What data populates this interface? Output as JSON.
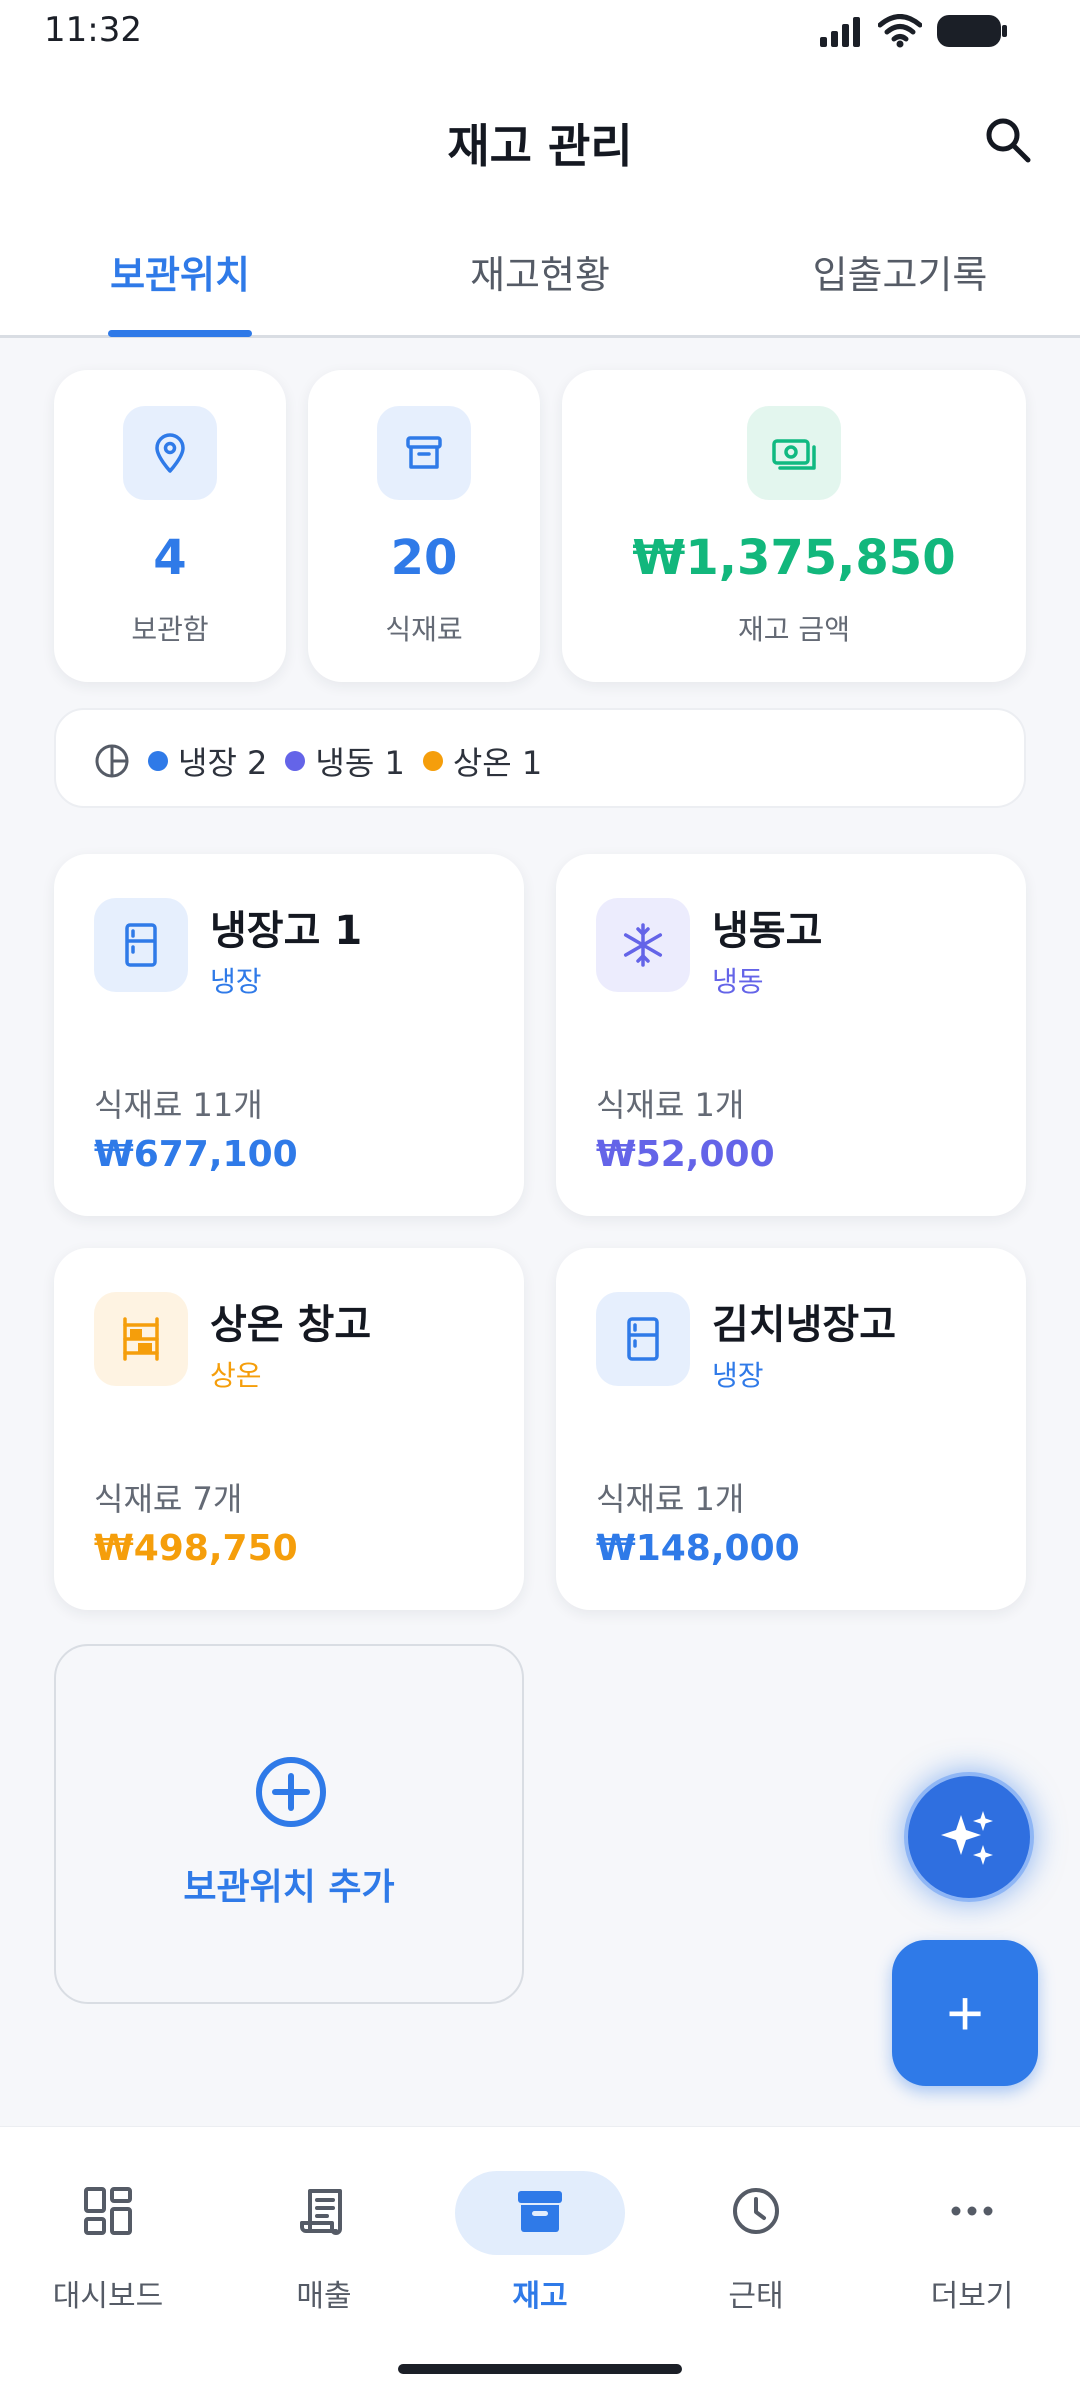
{
  "status": {
    "time": "11:32"
  },
  "header": {
    "title": "재고 관리",
    "search_icon": "search-icon"
  },
  "tabs": [
    {
      "label": "보관위치",
      "active": true
    },
    {
      "label": "재고현황",
      "active": false
    },
    {
      "label": "입출고기록",
      "active": false
    }
  ],
  "stats": {
    "storage": {
      "value": "4",
      "label": "보관함",
      "icon": "map-pin-icon"
    },
    "ingredients": {
      "value": "20",
      "label": "식재료",
      "icon": "archive-box-icon"
    },
    "amount": {
      "value": "₩1,375,850",
      "label": "재고 금액",
      "icon": "cash-icon"
    }
  },
  "legend": {
    "icon": "pie-chart-icon",
    "items": [
      {
        "label": "냉장 2",
        "color": "#2f7ae8"
      },
      {
        "label": "냉동 1",
        "color": "#6464e8"
      },
      {
        "label": "상온 1",
        "color": "#f59e0b"
      }
    ]
  },
  "locations": [
    {
      "name": "냉장고 1",
      "type": "냉장",
      "count": "식재료 11개",
      "amount": "₩677,100",
      "icon": "fridge-icon",
      "color": "#2f7ae8"
    },
    {
      "name": "냉동고",
      "type": "냉동",
      "count": "식재료 1개",
      "amount": "₩52,000",
      "icon": "snowflake-icon",
      "color": "#6464e8"
    },
    {
      "name": "상온 창고",
      "type": "상온",
      "count": "식재료 7개",
      "amount": "₩498,750",
      "icon": "shelf-icon",
      "color": "#f59e0b"
    },
    {
      "name": "김치냉장고",
      "type": "냉장",
      "count": "식재료 1개",
      "amount": "₩148,000",
      "icon": "fridge-icon",
      "color": "#2f7ae8"
    }
  ],
  "add_location": {
    "label": "보관위치 추가",
    "icon": "plus-circle-icon"
  },
  "fabs": {
    "ai_icon": "sparkle-icon",
    "add_icon": "plus-icon",
    "add_symbol": "+"
  },
  "bottom_nav": [
    {
      "label": "대시보드",
      "icon": "dashboard-icon",
      "active": false
    },
    {
      "label": "매출",
      "icon": "receipt-icon",
      "active": false
    },
    {
      "label": "재고",
      "icon": "archive-box-icon",
      "active": true
    },
    {
      "label": "근태",
      "icon": "clock-icon",
      "active": false
    },
    {
      "label": "더보기",
      "icon": "more-icon",
      "active": false
    }
  ]
}
